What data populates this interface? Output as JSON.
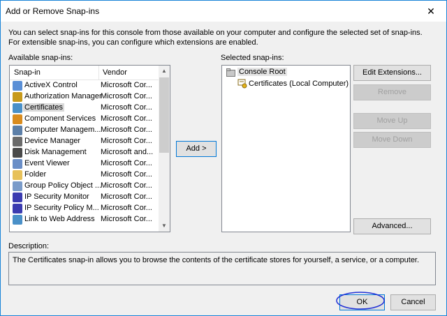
{
  "window": {
    "title": "Add or Remove Snap-ins",
    "close_glyph": "✕"
  },
  "intro_text": "You can select snap-ins for this console from those available on your computer and configure the selected set of snap-ins. For extensible snap-ins, you can configure which extensions are enabled.",
  "available": {
    "label": "Available snap-ins:",
    "columns": [
      "Snap-in",
      "Vendor"
    ],
    "rows": [
      {
        "name": "ActiveX Control",
        "vendor": "Microsoft Cor...",
        "icon": "activex-icon"
      },
      {
        "name": "Authorization Manager",
        "vendor": "Microsoft Cor...",
        "icon": "authorization-icon"
      },
      {
        "name": "Certificates",
        "vendor": "Microsoft Cor...",
        "icon": "certificates-icon",
        "selected": true
      },
      {
        "name": "Component Services",
        "vendor": "Microsoft Cor...",
        "icon": "component-services-icon"
      },
      {
        "name": "Computer Managem...",
        "vendor": "Microsoft Cor...",
        "icon": "computer-management-icon"
      },
      {
        "name": "Device Manager",
        "vendor": "Microsoft Cor...",
        "icon": "device-manager-icon"
      },
      {
        "name": "Disk Management",
        "vendor": "Microsoft and...",
        "icon": "disk-management-icon"
      },
      {
        "name": "Event Viewer",
        "vendor": "Microsoft Cor...",
        "icon": "event-viewer-icon"
      },
      {
        "name": "Folder",
        "vendor": "Microsoft Cor...",
        "icon": "folder-icon"
      },
      {
        "name": "Group Policy Object ...",
        "vendor": "Microsoft Cor...",
        "icon": "group-policy-icon"
      },
      {
        "name": "IP Security Monitor",
        "vendor": "Microsoft Cor...",
        "icon": "ip-security-monitor-icon"
      },
      {
        "name": "IP Security Policy M...",
        "vendor": "Microsoft Cor...",
        "icon": "ip-security-policy-icon"
      },
      {
        "name": "Link to Web Address",
        "vendor": "Microsoft Cor...",
        "icon": "link-icon"
      }
    ]
  },
  "add_button": "Add >",
  "selected": {
    "label": "Selected snap-ins:",
    "root": "Console Root",
    "child": "Certificates (Local Computer)"
  },
  "buttons": {
    "edit_extensions": "Edit Extensions...",
    "remove": "Remove",
    "move_up": "Move Up",
    "move_down": "Move Down",
    "advanced": "Advanced...",
    "ok": "OK",
    "cancel": "Cancel"
  },
  "description": {
    "label": "Description:",
    "text": "The Certificates snap-in allows you to browse the contents of the certificate stores for yourself, a service, or a computer."
  },
  "colors": {
    "accent": "#0078d7",
    "annotation": "#1f2fd6",
    "selection": "#d9d9d9"
  }
}
